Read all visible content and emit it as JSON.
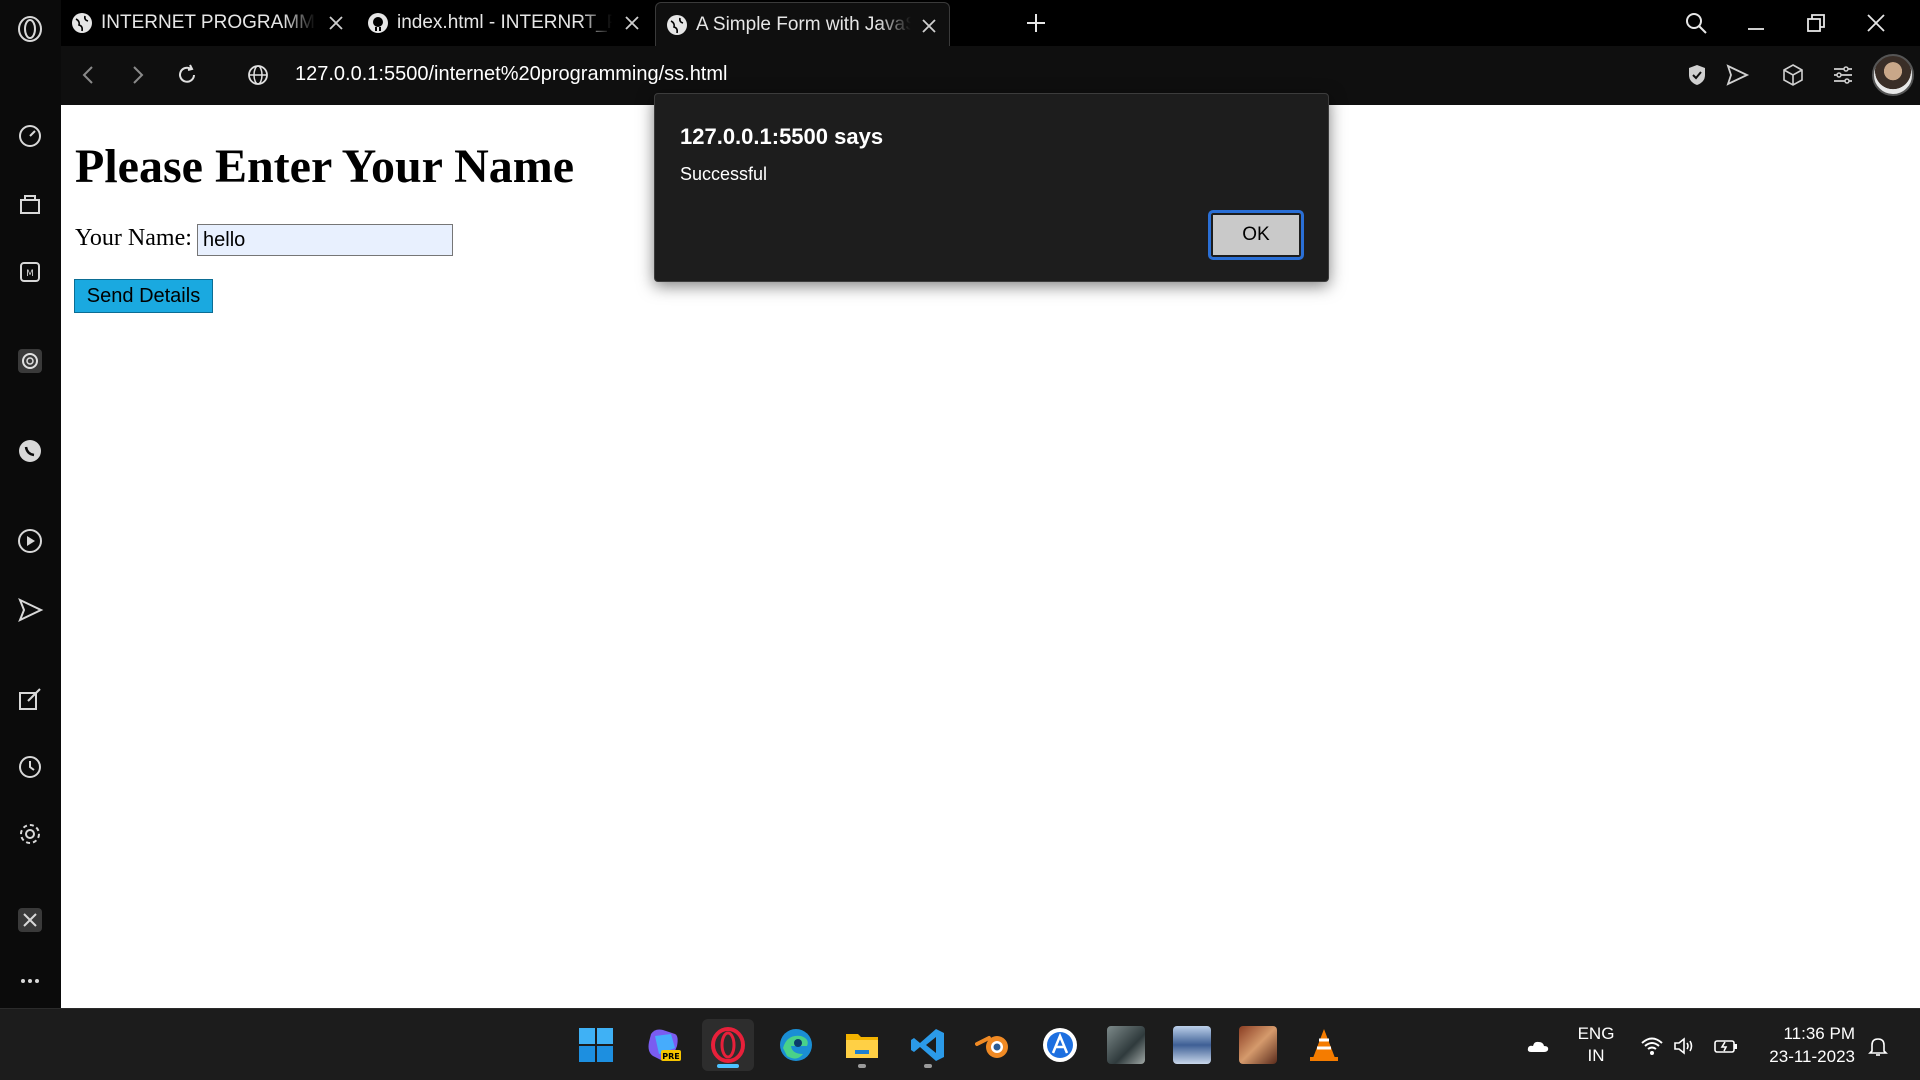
{
  "browser": {
    "tabs": [
      {
        "title": "INTERNET PROGRAMMING",
        "icon": "globe-icon",
        "active": false
      },
      {
        "title": "index.html - INTERNRT_PROGRAMMING",
        "icon": "github-icon",
        "active": false
      },
      {
        "title": "A Simple Form with JavaScript",
        "icon": "globe-icon",
        "active": true
      }
    ],
    "url": "127.0.0.1:5500/internet%20programming/ss.html"
  },
  "page": {
    "heading": "Please Enter Your Name",
    "name_label": "Your Name:",
    "name_value": "hello",
    "send_button": "Send Details"
  },
  "alert": {
    "title": "127.0.0.1:5500 says",
    "message": "Successful",
    "ok_label": "OK"
  },
  "taskbar": {
    "apps": [
      "windows-start",
      "copilot-pre",
      "opera",
      "edge",
      "file-explorer",
      "vscode",
      "blender",
      "app-store",
      "photo-app-1",
      "photo-app-2",
      "photo-app-3",
      "vlc"
    ],
    "pre_badge": "PRE",
    "language": {
      "line1": "ENG",
      "line2": "IN"
    },
    "time": "11:36 PM",
    "date": "23-11-2023"
  },
  "colors": {
    "send_button_bg": "#1aa9e0",
    "input_bg": "#e8f0fe",
    "ok_focus_ring": "#2a6fd6",
    "accent": "#4cc2ff"
  }
}
